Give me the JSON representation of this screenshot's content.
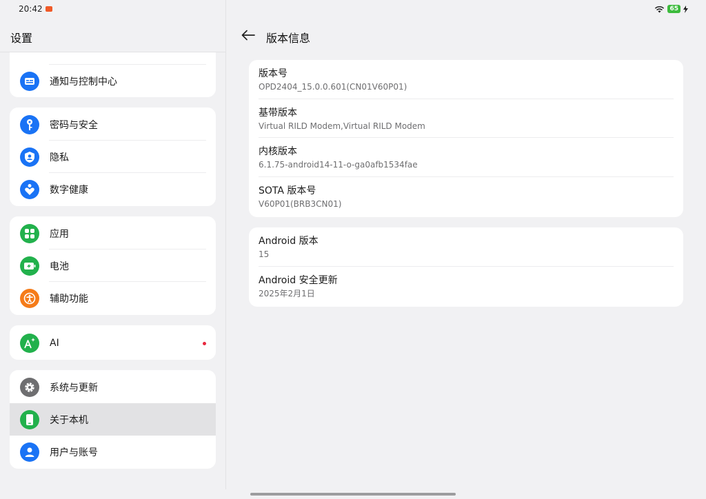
{
  "status": {
    "time": "20:42",
    "battery": "65"
  },
  "left": {
    "title": "设置",
    "groups": [
      {
        "items": [
          {
            "label": "通知与控制中心",
            "icon": "notification-icon",
            "color": "#1a73f5"
          }
        ]
      },
      {
        "items": [
          {
            "label": "密码与安全",
            "icon": "key-icon",
            "color": "#1a73f5"
          },
          {
            "label": "隐私",
            "icon": "privacy-shield-icon",
            "color": "#1a73f5"
          },
          {
            "label": "数字健康",
            "icon": "digital-wellbeing-icon",
            "color": "#1a73f5"
          }
        ]
      },
      {
        "items": [
          {
            "label": "应用",
            "icon": "apps-grid-icon",
            "color": "#22b14c"
          },
          {
            "label": "电池",
            "icon": "battery-icon",
            "color": "#22b14c"
          },
          {
            "label": "辅助功能",
            "icon": "accessibility-icon",
            "color": "#f57c1a"
          }
        ]
      },
      {
        "items": [
          {
            "label": "AI",
            "icon": "ai-sparkle-icon",
            "color": "#22b14c"
          }
        ]
      },
      {
        "items": [
          {
            "label": "系统与更新",
            "icon": "gear-icon",
            "color": "#6e6e70"
          },
          {
            "label": "关于本机",
            "icon": "phone-icon",
            "color": "#22b14c"
          },
          {
            "label": "用户与账号",
            "icon": "user-icon",
            "color": "#1a73f5"
          }
        ]
      }
    ]
  },
  "right": {
    "title": "版本信息",
    "card1": [
      {
        "label": "版本号",
        "value": "OPD2404_15.0.0.601(CN01V60P01)"
      },
      {
        "label": "基带版本",
        "value": "Virtual RILD Modem,Virtual RILD Modem"
      },
      {
        "label": "内核版本",
        "value": "6.1.75-android14-11-o-ga0afb1534fae"
      },
      {
        "label": "SOTA 版本号",
        "value": "V60P01(BRB3CN01)"
      }
    ],
    "card2": [
      {
        "label": "Android 版本",
        "value": "15"
      },
      {
        "label": "Android 安全更新",
        "value": "2025年2月1日"
      }
    ]
  },
  "colors": {
    "accent_blue": "#1a73f5",
    "accent_green": "#22b14c",
    "accent_orange": "#f57c1a",
    "notification_dot": "#e8273d"
  }
}
